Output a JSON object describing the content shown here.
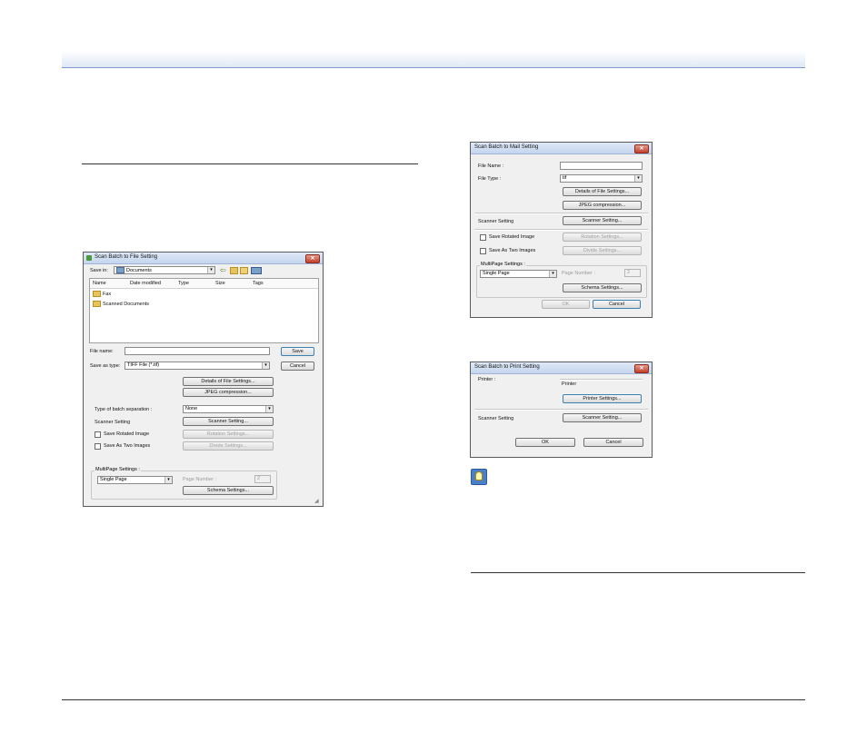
{
  "file_dialog": {
    "title": "Scan Batch to File Setting",
    "save_in_label": "Save in:",
    "save_in_value": "Documents",
    "columns": [
      "Name",
      "Date modified",
      "Type",
      "Size",
      "Tags"
    ],
    "items": [
      "Fax",
      "Scanned Documents"
    ],
    "file_name_label": "File name:",
    "file_name_value": "",
    "save_as_type_label": "Save as type:",
    "save_as_type_value": "TIFF File (*.tif)",
    "save_button": "Save",
    "cancel_button": "Cancel",
    "details_button": "Details of File Settings...",
    "jpeg_button": "JPEG compression...",
    "batch_sep_label": "Type of batch separation :",
    "batch_sep_value": "None",
    "scanner_setting_label": "Scanner Setting",
    "scanner_setting_button": "Scanner Setting...",
    "save_rotated_label": "Save Rotated Image",
    "rotation_button": "Rotation Settings...",
    "save_two_label": "Save As Two Images",
    "divide_button": "Divide Settings...",
    "multipage_label": "MultiPage Settings :",
    "multipage_value": "Single Page",
    "page_number_label": "Page Number :",
    "page_number_value": "2",
    "schema_button": "Schema Settings..."
  },
  "mail_dialog": {
    "title": "Scan Batch to Mail Setting",
    "file_name_label": "File Name :",
    "file_name_value": "",
    "file_type_label": "File Type :",
    "file_type_value": "tif",
    "details_button": "Details of File Settings...",
    "jpeg_button": "JPEG compression...",
    "scanner_setting_label": "Scanner Setting",
    "scanner_setting_button": "Scanner Setting...",
    "save_rotated_label": "Save Rotated Image",
    "rotation_button": "Rotation Settings...",
    "save_two_label": "Save As Two Images",
    "divide_button": "Divide Settings...",
    "multipage_label": "MultiPage Settings :",
    "multipage_value": "Single Page",
    "page_number_label": "Page Number :",
    "page_number_value": "2",
    "schema_button": "Schema Settings...",
    "ok_button": "OK",
    "cancel_button": "Cancel"
  },
  "print_dialog": {
    "title": "Scan Batch to Print Setting",
    "printer_label": "Printer :",
    "printer_value": "Printer",
    "printer_settings_button": "Printer Settings...",
    "scanner_setting_label": "Scanner Setting",
    "scanner_setting_button": "Scanner Setting...",
    "ok_button": "OK",
    "cancel_button": "Cancel"
  },
  "icons": {
    "close": "close-icon",
    "folder": "folder-icon",
    "hint": "lightbulb-icon"
  }
}
